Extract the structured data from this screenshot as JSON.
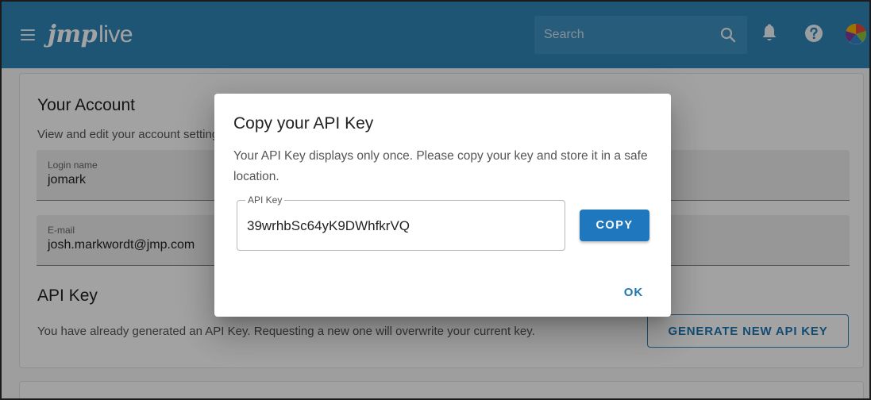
{
  "header": {
    "logo_bold": "jmp",
    "logo_light": "live",
    "search_placeholder": "Search",
    "icons": [
      "menu-icon",
      "search-icon",
      "bell-icon",
      "help-icon",
      "avatar"
    ],
    "bar_color": "#2f84b6"
  },
  "account": {
    "title": "Your Account",
    "subtitle": "View and edit your account settings.",
    "login_label": "Login name",
    "login_value": "jomark",
    "email_label": "E-mail",
    "email_value": "josh.markwordt@jmp.com"
  },
  "api": {
    "title": "API Key",
    "description": "You have already generated an API Key. Requesting a new one will overwrite your current key.",
    "generate_label": "GENERATE NEW API KEY"
  },
  "dialog": {
    "title": "Copy your API Key",
    "text": "Your API Key displays only once. Please copy your key and store it in a safe location.",
    "field_label": "API Key",
    "key_value": "39wrhbSc64yK9DWhfkrVQ",
    "copy_label": "COPY",
    "ok_label": "OK",
    "accent_color": "#1f77bd"
  }
}
